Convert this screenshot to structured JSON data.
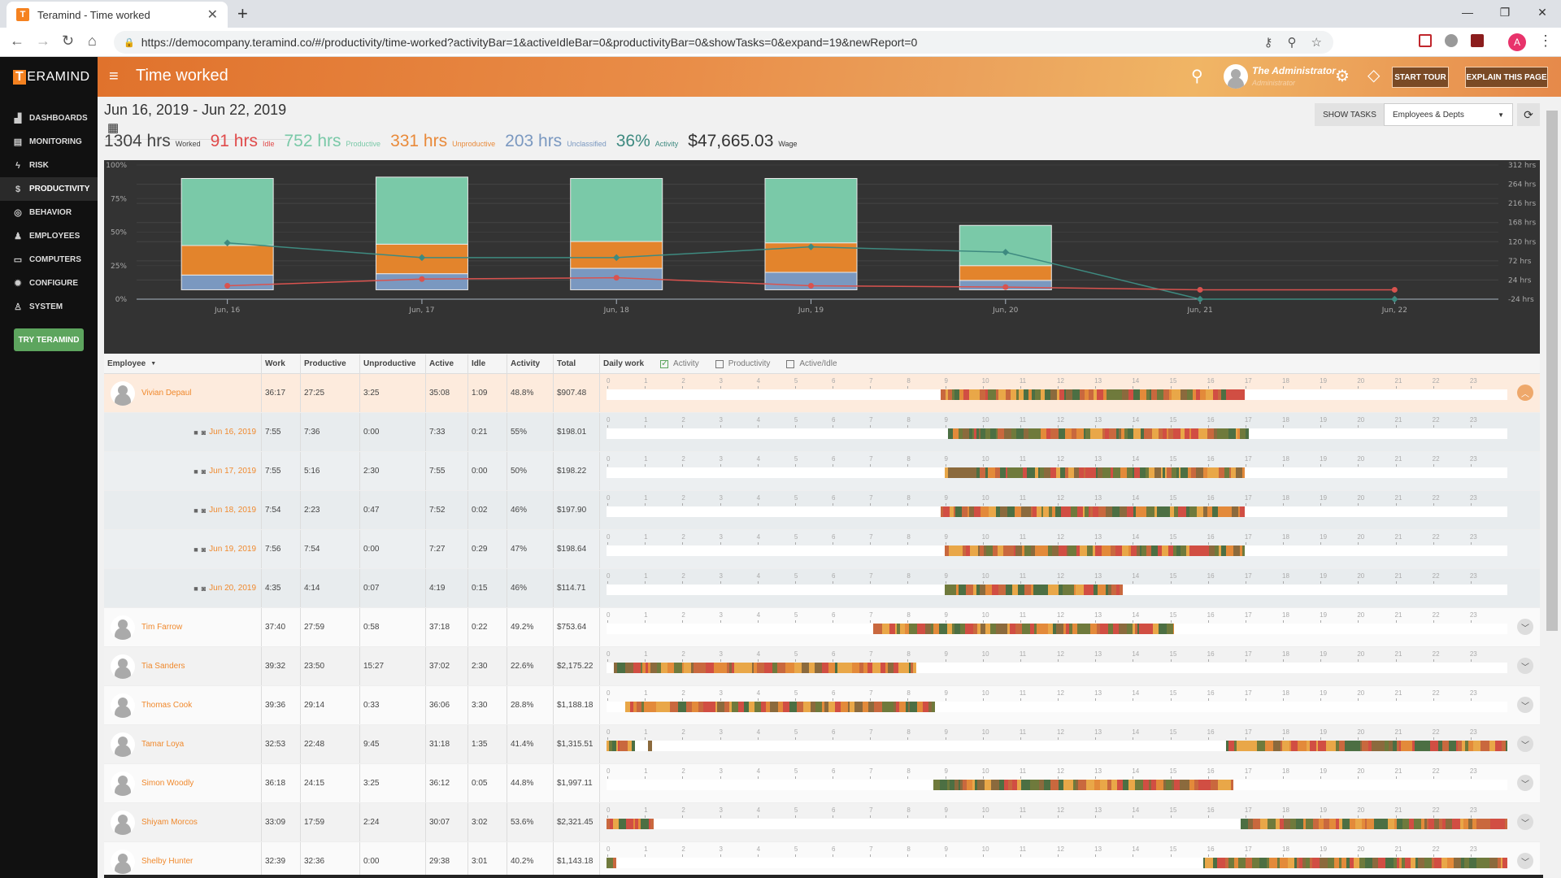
{
  "browser": {
    "tab_title": "Teramind - Time worked",
    "tab_favicon": "T",
    "url": "https://democompany.teramind.co/#/productivity/time-worked?activityBar=1&activeIdleBar=0&productivityBar=0&showTasks=0&expand=19&newReport=0",
    "profile_initial": "A"
  },
  "app": {
    "logo_letter": "T",
    "logo_text": "ERAMIND",
    "page_title": "Time worked",
    "user_name": "The Administrator",
    "user_role": "Administrator",
    "start_tour_label": "START TOUR",
    "explain_label": "EXPLAIN THIS PAGE"
  },
  "sidebar": {
    "items": [
      {
        "label": "DASHBOARDS",
        "icon": "chart-area-icon",
        "glyph": "▟"
      },
      {
        "label": "MONITORING",
        "icon": "document-icon",
        "glyph": "▤"
      },
      {
        "label": "RISK",
        "icon": "bolt-icon",
        "glyph": "ϟ"
      },
      {
        "label": "PRODUCTIVITY",
        "icon": "dollar-icon",
        "glyph": "$",
        "active": true
      },
      {
        "label": "BEHAVIOR",
        "icon": "gamepad-icon",
        "glyph": "◎"
      },
      {
        "label": "EMPLOYEES",
        "icon": "users-icon",
        "glyph": "♟"
      },
      {
        "label": "COMPUTERS",
        "icon": "monitor-icon",
        "glyph": "▭"
      },
      {
        "label": "CONFIGURE",
        "icon": "gear-icon",
        "glyph": "✹"
      },
      {
        "label": "SYSTEM",
        "icon": "user-search-icon",
        "glyph": "♙"
      }
    ],
    "try_label": "TRY TERAMIND"
  },
  "toolbar": {
    "date_range": "Jun 16, 2019 - Jun 22, 2019",
    "show_tasks_label": "SHOW TASKS",
    "group_select": "Employees & Depts"
  },
  "summary": [
    {
      "value": "1304 hrs",
      "label": "Worked",
      "color": "#444444"
    },
    {
      "value": "91 hrs",
      "label": "Idle",
      "color": "#e04b4b"
    },
    {
      "value": "752 hrs",
      "label": "Productive",
      "color": "#7ac9a8"
    },
    {
      "value": "331 hrs",
      "label": "Unproductive",
      "color": "#e98a3a"
    },
    {
      "value": "203 hrs",
      "label": "Unclassified",
      "color": "#7a98c0"
    },
    {
      "value": "36%",
      "label": "Activity",
      "color": "#3e8a80"
    },
    {
      "value": "$47,665.03",
      "label": "Wage",
      "color": "#333333"
    }
  ],
  "chart_data": {
    "type": "bar",
    "stacked": true,
    "categories": [
      "Jun, 16",
      "Jun, 17",
      "Jun, 18",
      "Jun, 19",
      "Jun, 20",
      "Jun, 21",
      "Jun, 22"
    ],
    "left_axis": {
      "ticks": [
        "0%",
        "25%",
        "50%",
        "75%",
        "100%"
      ],
      "ylim": [
        0,
        100
      ]
    },
    "right_axis": {
      "ticks": [
        "-24 hrs",
        "24 hrs",
        "72 hrs",
        "120 hrs",
        "168 hrs",
        "216 hrs",
        "264 hrs",
        "312 hrs"
      ],
      "ylim": [
        -24,
        312
      ]
    },
    "bar_base": 7,
    "series": [
      {
        "name": "Unclassified",
        "color": "#7a98c0",
        "values": [
          11,
          12,
          16,
          13,
          7,
          0,
          0
        ]
      },
      {
        "name": "Unproductive",
        "color": "#e3842c",
        "values": [
          22,
          22,
          20,
          22,
          11,
          0,
          0
        ]
      },
      {
        "name": "Productive",
        "color": "#7ac9a8",
        "values": [
          50,
          50,
          47,
          48,
          30,
          0,
          0
        ]
      }
    ],
    "lines": [
      {
        "name": "Activity",
        "color": "#3e8a80",
        "marker": "diamond",
        "values": [
          42,
          31,
          31,
          39,
          35,
          0,
          0
        ]
      },
      {
        "name": "Idle",
        "color": "#d9534f",
        "marker": "circle",
        "values": [
          10,
          15,
          16,
          10,
          9,
          7,
          7
        ]
      }
    ],
    "grid": true
  },
  "table": {
    "columns": [
      "Employee",
      "Work",
      "Productive",
      "Unproductive",
      "Active",
      "Idle",
      "Activity",
      "Total",
      "Daily work"
    ],
    "daily_options": [
      {
        "label": "Activity",
        "checked": true
      },
      {
        "label": "Productivity",
        "checked": false
      },
      {
        "label": "Active/Idle",
        "checked": false
      }
    ],
    "hours": [
      "0",
      "1",
      "2",
      "3",
      "4",
      "5",
      "6",
      "7",
      "8",
      "9",
      "10",
      "11",
      "12",
      "13",
      "14",
      "15",
      "16",
      "17",
      "18",
      "19",
      "20",
      "21",
      "22",
      "23"
    ],
    "rows": [
      {
        "type": "employee",
        "name": "Vivian Depaul",
        "work": "36:17",
        "productive": "27:25",
        "unproductive": "3:25",
        "active": "35:08",
        "idle": "1:09",
        "activity": "48.8%",
        "total": "$907.48",
        "expanded": true,
        "spans": [
          [
            8.9,
            17.0
          ]
        ]
      },
      {
        "type": "day",
        "date": "Jun 16, 2019",
        "work": "7:55",
        "productive": "7:36",
        "unproductive": "0:00",
        "active": "7:33",
        "idle": "0:21",
        "activity": "55%",
        "total": "$198.01",
        "spans": [
          [
            9.1,
            17.1
          ]
        ]
      },
      {
        "type": "day",
        "date": "Jun 17, 2019",
        "work": "7:55",
        "productive": "5:16",
        "unproductive": "2:30",
        "active": "7:55",
        "idle": "0:00",
        "activity": "50%",
        "total": "$198.22",
        "spans": [
          [
            9.0,
            17.0
          ]
        ]
      },
      {
        "type": "day",
        "date": "Jun 18, 2019",
        "work": "7:54",
        "productive": "2:23",
        "unproductive": "0:47",
        "active": "7:52",
        "idle": "0:02",
        "activity": "46%",
        "total": "$197.90",
        "spans": [
          [
            8.9,
            17.0
          ]
        ]
      },
      {
        "type": "day",
        "date": "Jun 19, 2019",
        "work": "7:56",
        "productive": "7:54",
        "unproductive": "0:00",
        "active": "7:27",
        "idle": "0:29",
        "activity": "47%",
        "total": "$198.64",
        "spans": [
          [
            9.0,
            17.0
          ]
        ]
      },
      {
        "type": "day",
        "date": "Jun 20, 2019",
        "work": "4:35",
        "productive": "4:14",
        "unproductive": "0:07",
        "active": "4:19",
        "idle": "0:15",
        "activity": "46%",
        "total": "$114.71",
        "spans": [
          [
            9.0,
            13.75
          ]
        ]
      },
      {
        "type": "employee",
        "name": "Tim Farrow",
        "work": "37:40",
        "productive": "27:59",
        "unproductive": "0:58",
        "active": "37:18",
        "idle": "0:22",
        "activity": "49.2%",
        "total": "$753.64",
        "spans": [
          [
            7.1,
            15.1
          ]
        ]
      },
      {
        "type": "employee",
        "name": "Tia Sanders",
        "work": "39:32",
        "productive": "23:50",
        "unproductive": "15:27",
        "active": "37:02",
        "idle": "2:30",
        "activity": "22.6%",
        "total": "$2,175.22",
        "spans": [
          [
            0.2,
            8.25
          ]
        ]
      },
      {
        "type": "employee",
        "name": "Thomas Cook",
        "work": "39:36",
        "productive": "29:14",
        "unproductive": "0:33",
        "active": "36:06",
        "idle": "3:30",
        "activity": "28.8%",
        "total": "$1,188.18",
        "spans": [
          [
            0.5,
            8.75
          ]
        ]
      },
      {
        "type": "employee",
        "name": "Tamar Loya",
        "work": "32:53",
        "productive": "22:48",
        "unproductive": "9:45",
        "active": "31:18",
        "idle": "1:35",
        "activity": "41.4%",
        "total": "$1,315.51",
        "spans": [
          [
            0.0,
            0.75
          ],
          [
            1.1,
            1.2
          ],
          [
            16.5,
            24.0
          ]
        ]
      },
      {
        "type": "employee",
        "name": "Simon Woodly",
        "work": "36:18",
        "productive": "24:15",
        "unproductive": "3:25",
        "active": "36:12",
        "idle": "0:05",
        "activity": "44.8%",
        "total": "$1,997.11",
        "spans": [
          [
            8.7,
            16.7
          ]
        ]
      },
      {
        "type": "employee",
        "name": "Shiyam Morcos",
        "work": "33:09",
        "productive": "17:59",
        "unproductive": "2:24",
        "active": "30:07",
        "idle": "3:02",
        "activity": "53.6%",
        "total": "$2,321.45",
        "spans": [
          [
            0.0,
            1.25
          ],
          [
            16.9,
            24.0
          ]
        ]
      },
      {
        "type": "employee",
        "name": "Shelby Hunter",
        "work": "32:39",
        "productive": "32:36",
        "unproductive": "0:00",
        "active": "29:38",
        "idle": "3:01",
        "activity": "40.2%",
        "total": "$1,143.18",
        "spans": [
          [
            0.0,
            0.25
          ],
          [
            15.9,
            24.0
          ]
        ]
      }
    ],
    "activity_colors": [
      "#d14e43",
      "#e9a748",
      "#4c6f43",
      "#c9683e",
      "#8b6a3d",
      "#e38a3a",
      "#6f7a3c"
    ]
  }
}
